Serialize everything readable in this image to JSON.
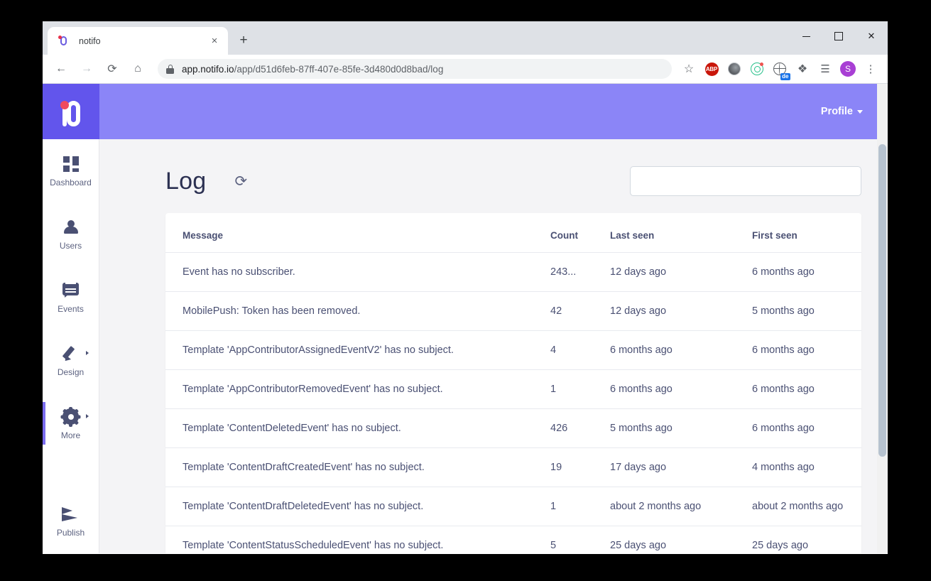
{
  "browser": {
    "tab": {
      "title": "notifo",
      "favicon_icon": "notifo-bell-icon",
      "close_label": "×"
    },
    "new_tab_label": "+",
    "window_controls": {
      "minimize": "–",
      "maximize": "□",
      "close": "✕"
    },
    "nav": {
      "back": "←",
      "forward": "→",
      "reload": "⟳",
      "home": "⌂"
    },
    "omnibox": {
      "lock_icon": "lock-icon",
      "host": "app.notifo.io",
      "path": "/app/d51d6feb-87ff-407e-85fe-3d480d0d8bad/log",
      "full_url": "app.notifo.io/app/d51d6feb-87ff-407e-85fe-3d480d0d8bad/log"
    },
    "toolbar_icons": [
      {
        "name": "bookmark-star-icon",
        "glyph": "☆"
      },
      {
        "name": "adblock-plus-icon",
        "glyph": "ABP"
      },
      {
        "name": "dark-mode-moon-icon",
        "glyph": ""
      },
      {
        "name": "radar-tracker-icon",
        "glyph": ""
      },
      {
        "name": "translate-globe-icon",
        "glyph": "",
        "badge": "de"
      },
      {
        "name": "extensions-puzzle-icon",
        "glyph": "❖"
      },
      {
        "name": "reading-list-icon",
        "glyph": "☰"
      },
      {
        "name": "profile-avatar-icon",
        "glyph": "S"
      },
      {
        "name": "chrome-menu-icon",
        "glyph": "⋮"
      }
    ]
  },
  "app": {
    "logo_name": "notifo-logo",
    "profile_label": "Profile",
    "colors": {
      "header_bg": "#8b85f7",
      "logo_bg": "#6255ec",
      "accent": "#7b6df0",
      "text": "#4a5073",
      "page_bg": "#f4f4f6"
    }
  },
  "sidebar": {
    "items": [
      {
        "label": "Dashboard",
        "icon": "grid-icon",
        "active": false,
        "has_chevron": false
      },
      {
        "label": "Users",
        "icon": "person-icon",
        "active": false,
        "has_chevron": false
      },
      {
        "label": "Events",
        "icon": "chat-bubble-icon",
        "active": false,
        "has_chevron": false
      },
      {
        "label": "Design",
        "icon": "pencil-icon",
        "active": false,
        "has_chevron": true
      },
      {
        "label": "More",
        "icon": "gear-icon",
        "active": true,
        "has_chevron": true
      },
      {
        "label": "Publish",
        "icon": "send-icon",
        "active": false,
        "has_chevron": false
      }
    ]
  },
  "main": {
    "title": "Log",
    "refresh_icon": "refresh-icon",
    "search": {
      "value": "",
      "placeholder": ""
    },
    "table": {
      "columns": [
        "Message",
        "Count",
        "Last seen",
        "First seen"
      ],
      "rows": [
        {
          "message": "Event has no subscriber.",
          "count": "243...",
          "last_seen": "12 days ago",
          "first_seen": "6 months ago"
        },
        {
          "message": "MobilePush: Token has been removed.",
          "count": "42",
          "last_seen": "12 days ago",
          "first_seen": "5 months ago"
        },
        {
          "message": "Template 'AppContributorAssignedEventV2' has no subject.",
          "count": "4",
          "last_seen": "6 months ago",
          "first_seen": "6 months ago"
        },
        {
          "message": "Template 'AppContributorRemovedEvent' has no subject.",
          "count": "1",
          "last_seen": "6 months ago",
          "first_seen": "6 months ago"
        },
        {
          "message": "Template 'ContentDeletedEvent' has no subject.",
          "count": "426",
          "last_seen": "5 months ago",
          "first_seen": "6 months ago"
        },
        {
          "message": "Template 'ContentDraftCreatedEvent' has no subject.",
          "count": "19",
          "last_seen": "17 days ago",
          "first_seen": "4 months ago"
        },
        {
          "message": "Template 'ContentDraftDeletedEvent' has no subject.",
          "count": "1",
          "last_seen": "about 2 months ago",
          "first_seen": "about 2 months ago"
        },
        {
          "message": "Template 'ContentStatusScheduledEvent' has no subject.",
          "count": "5",
          "last_seen": "25 days ago",
          "first_seen": "25 days ago"
        }
      ]
    }
  }
}
